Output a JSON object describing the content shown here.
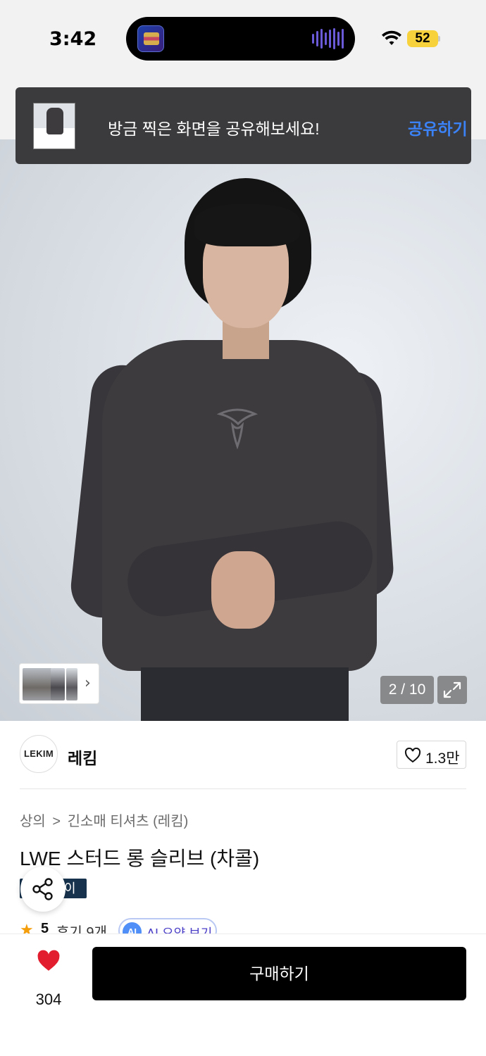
{
  "status_bar": {
    "time": "3:42",
    "battery": "52",
    "battery_color": "#f7d23c"
  },
  "share_toast": {
    "message": "방금 찍은 화면을 공유해보세요!",
    "action_label": "공유하기",
    "action_color": "#3b82f6"
  },
  "gallery": {
    "counter": "2 / 10",
    "thumbnail_strip_icon": "chevron-right-icon",
    "expand_icon": "expand-icon"
  },
  "brand": {
    "logo_text": "LEKIM",
    "name": "레킴",
    "like_count": "1.3만"
  },
  "product": {
    "breadcrumb": [
      "상의",
      "긴소매 티셔츠 (레킴)"
    ],
    "breadcrumb_separator": ">",
    "title": "LWE 스터드 롱 슬리브 (차콜)",
    "tag": "이",
    "tag_color": "#17324d",
    "rating": "5",
    "review_text": "후기 9개",
    "ai_badge": "AI",
    "ai_label": "AI 요약 보기"
  },
  "bottom_bar": {
    "wishlist_count": "304",
    "wishlist_color": "#e11d2e",
    "buy_label": "구매하기"
  }
}
